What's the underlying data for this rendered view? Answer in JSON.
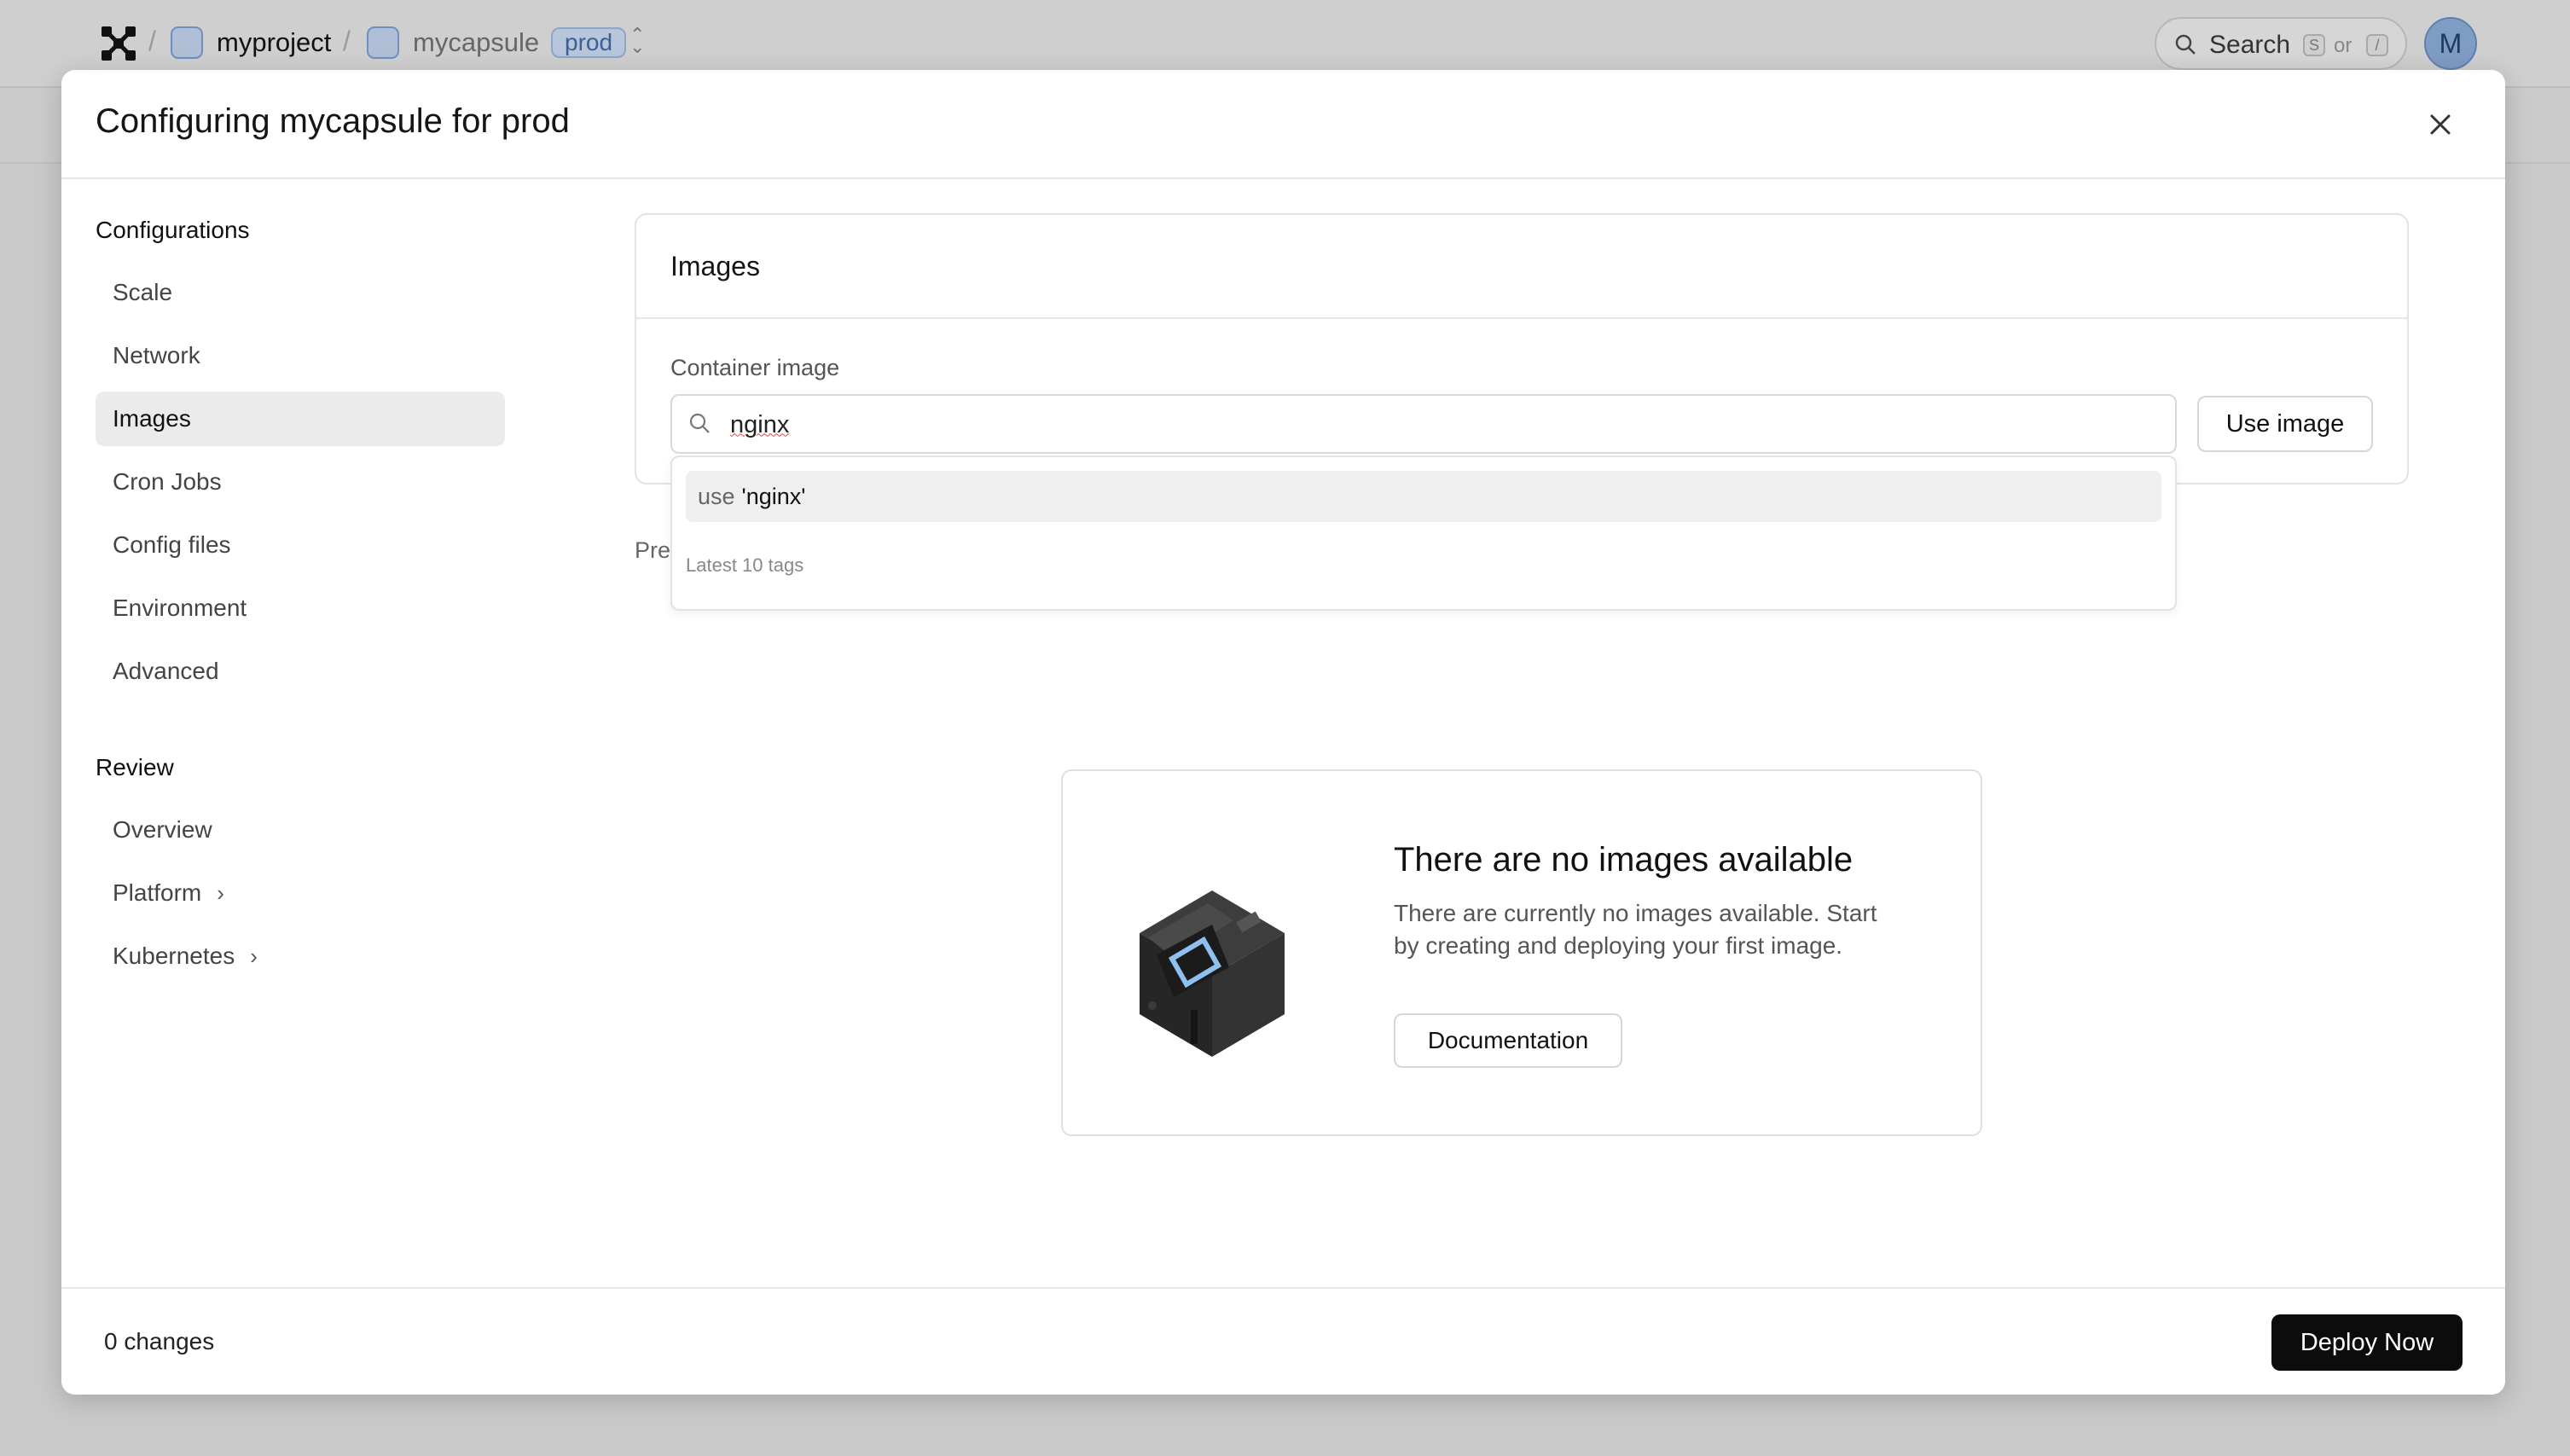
{
  "topbar": {
    "project": "myproject",
    "capsule": "mycapsule",
    "environment": "prod",
    "search_label": "Search",
    "search_key_1": "S",
    "search_or": "or",
    "search_key_2": "/",
    "avatar_initial": "M"
  },
  "modal": {
    "title": "Configuring mycapsule for prod"
  },
  "sidebar": {
    "configurations_heading": "Configurations",
    "configurations": [
      {
        "label": "Scale"
      },
      {
        "label": "Network"
      },
      {
        "label": "Images",
        "active": true
      },
      {
        "label": "Cron Jobs"
      },
      {
        "label": "Config files"
      },
      {
        "label": "Environment"
      },
      {
        "label": "Advanced"
      }
    ],
    "review_heading": "Review",
    "review": [
      {
        "label": "Overview"
      },
      {
        "label": "Platform"
      },
      {
        "label": "Kubernetes"
      }
    ]
  },
  "images_card": {
    "title": "Images",
    "field_label": "Container image",
    "input_value": "nginx",
    "use_button": "Use image"
  },
  "dropdown": {
    "option_prefix": "use",
    "option_value": "'nginx'",
    "caption": "Latest 10 tags"
  },
  "partial_text": "Pre",
  "empty_state": {
    "title": "There are no images available",
    "description": "There are currently no images available. Start by creating and deploying your first image.",
    "button": "Documentation"
  },
  "footer": {
    "changes": "0 changes",
    "deploy_button": "Deploy Now"
  },
  "colors": {
    "accent": "#0c0c0c",
    "env_badge": "#b8c6dc",
    "active_item": "#ebebeb"
  }
}
